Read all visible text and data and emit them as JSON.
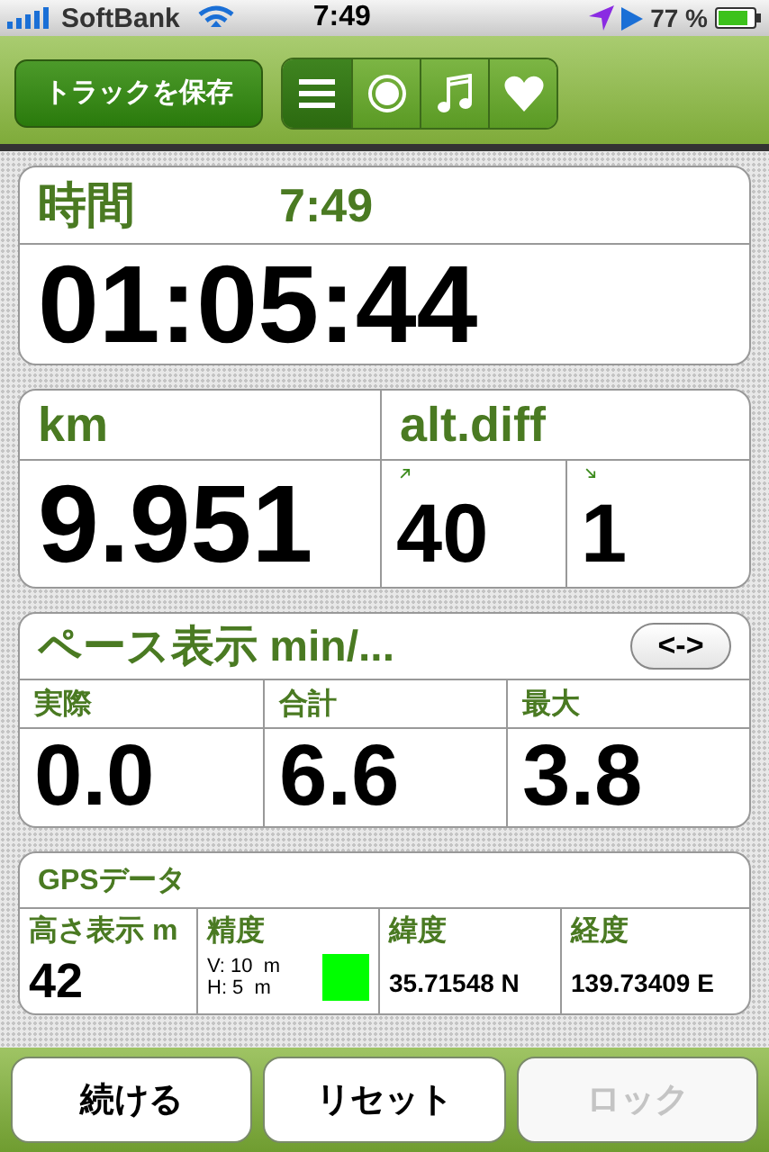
{
  "status_bar": {
    "carrier": "SoftBank",
    "time": "7:49",
    "battery": "77 %"
  },
  "toolbar": {
    "save_button": "トラックを保存",
    "segments": [
      {
        "kind": "list",
        "selected": true
      },
      {
        "kind": "record",
        "selected": false
      },
      {
        "kind": "music",
        "selected": false
      },
      {
        "kind": "heart",
        "selected": false
      }
    ]
  },
  "time_card": {
    "label": "時間",
    "clock": "7:49",
    "value": "01:05:44"
  },
  "distance_card": {
    "label": "km",
    "value": "9.951"
  },
  "alt_card": {
    "label": "alt.diff",
    "up": "40",
    "down": "1"
  },
  "pace_card": {
    "title": "ペース表示 min/...",
    "toggle_button": "<->",
    "cells": [
      {
        "label": "実際",
        "value": "0.0"
      },
      {
        "label": "合計",
        "value": "6.6"
      },
      {
        "label": "最大",
        "value": "3.8"
      }
    ]
  },
  "gps_card": {
    "title": "GPSデータ",
    "altitude": {
      "label": "高さ表示 m",
      "value": "42"
    },
    "accuracy": {
      "label": "精度",
      "vertical": "V: 10  m",
      "horizontal": "H: 5  m",
      "color": "#00ff00"
    },
    "latitude": {
      "label": "緯度",
      "value": "35.71548 N"
    },
    "longitude": {
      "label": "経度",
      "value": "139.73409 E"
    }
  },
  "bottom_buttons": [
    {
      "label": "続ける",
      "disabled": false
    },
    {
      "label": "リセット",
      "disabled": false
    },
    {
      "label": "ロック",
      "disabled": true
    }
  ]
}
